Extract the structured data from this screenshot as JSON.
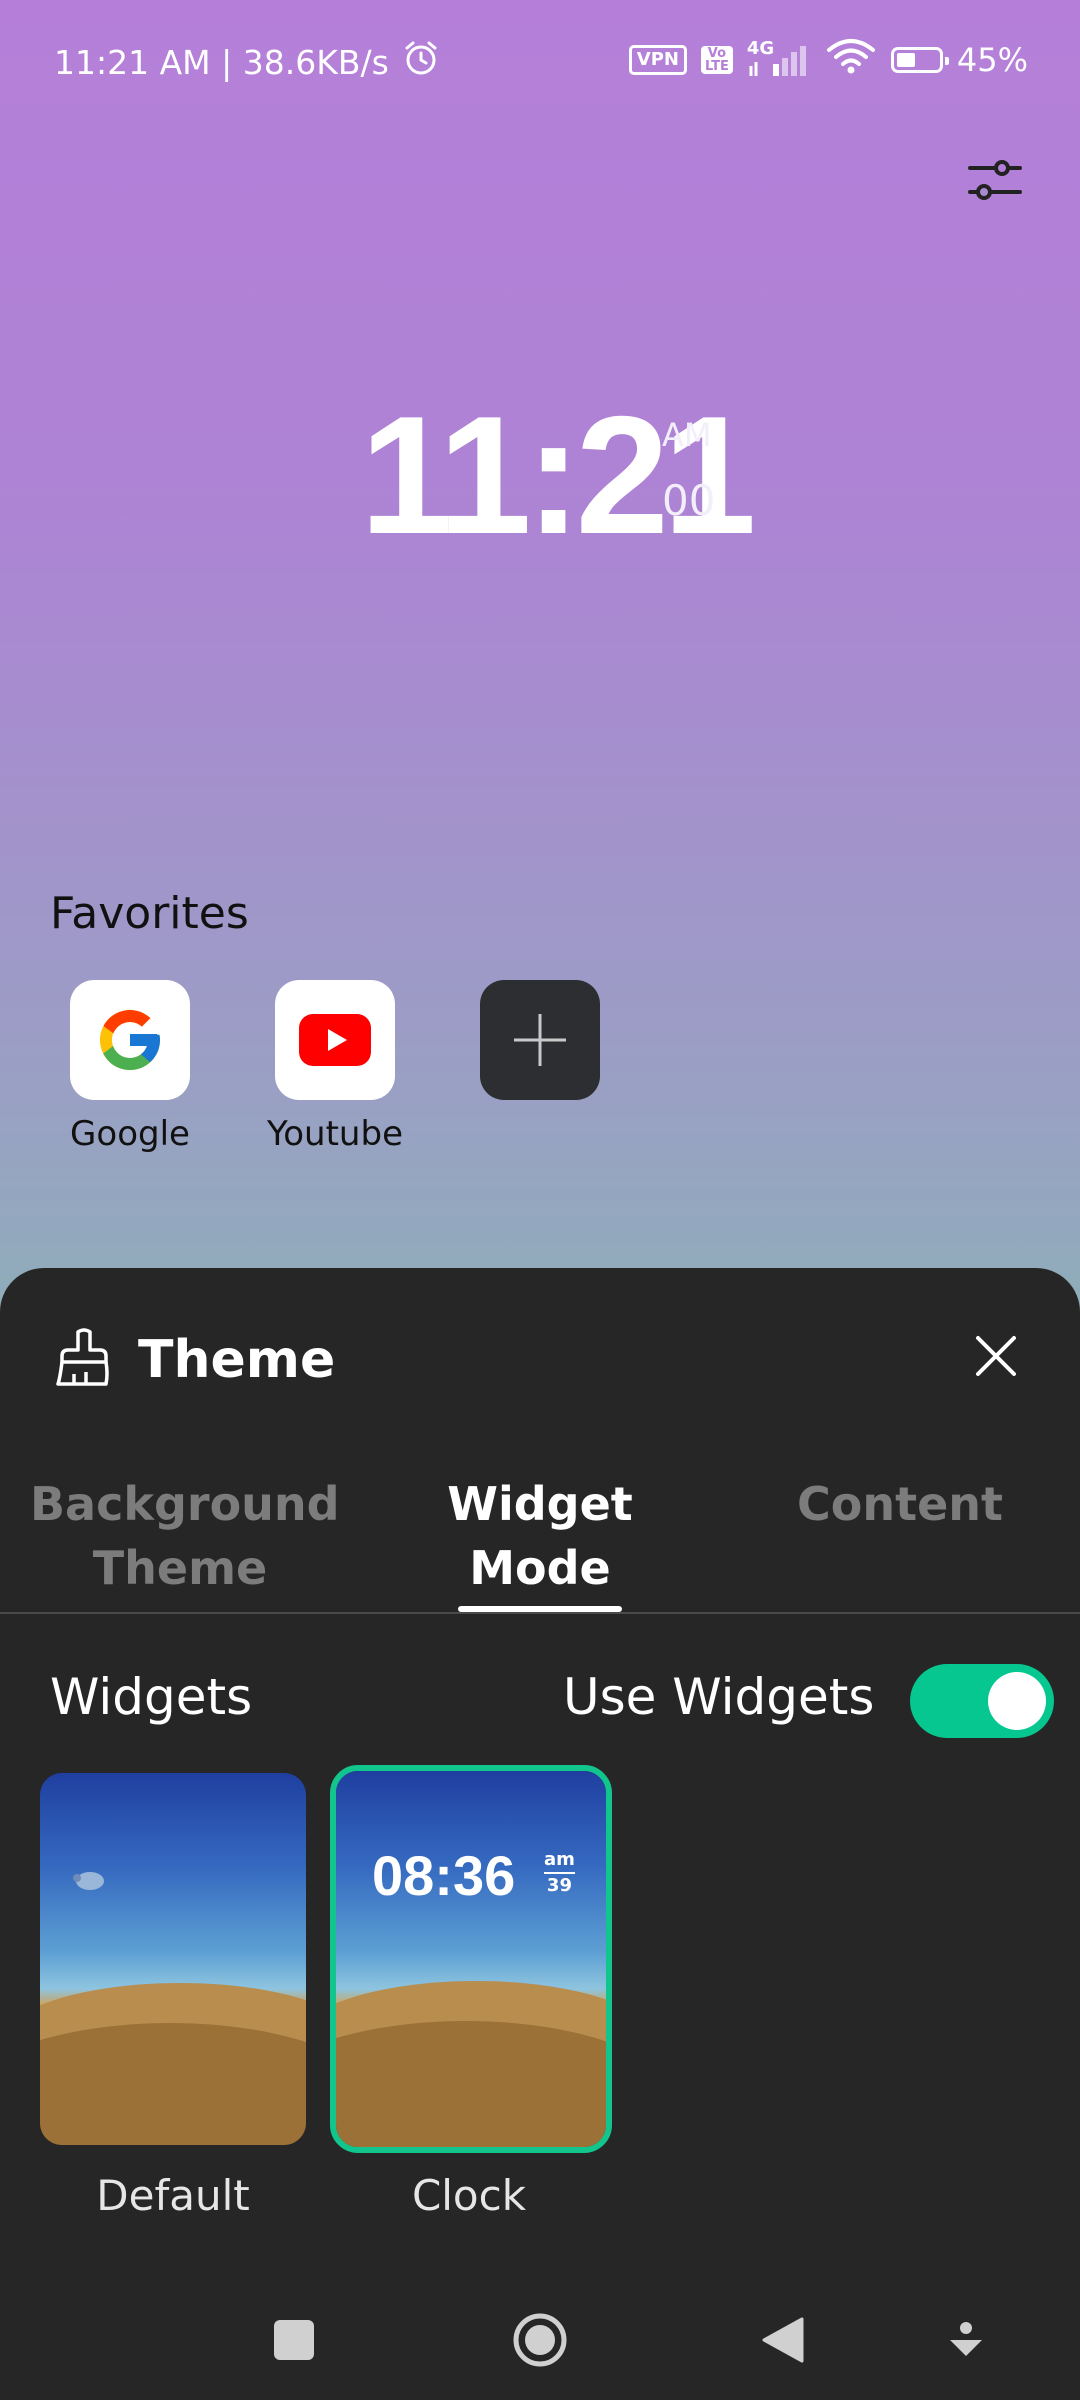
{
  "status_bar": {
    "time_speed": "11:21 AM | 38.6KB/s",
    "vpn": "VPN",
    "volte_top": "Vo",
    "volte_bottom": "LTE",
    "network": "4G",
    "battery": "45%",
    "battery_level": 0.45
  },
  "home": {
    "clock_time": "11:21",
    "clock_ampm": "AM",
    "clock_seconds": "00",
    "favorites_title": "Favorites",
    "favorites": [
      {
        "label": "Google",
        "icon": "google-icon"
      },
      {
        "label": "Youtube",
        "icon": "youtube-icon"
      },
      {
        "label": "",
        "icon": "plus-icon"
      }
    ]
  },
  "sheet": {
    "title": "Theme",
    "tabs": [
      {
        "label": "Background Theme",
        "active": false
      },
      {
        "label": "Widget Mode",
        "active": true
      },
      {
        "label": "Content",
        "active": false
      }
    ],
    "widgets_title": "Widgets",
    "use_widgets_label": "Use Widgets",
    "use_widgets_enabled": true,
    "widget_options": [
      {
        "label": "Default",
        "selected": false
      },
      {
        "label": "Clock",
        "selected": true,
        "preview_time": "08:36",
        "preview_ampm": "am",
        "preview_seconds": "39"
      }
    ]
  },
  "colors": {
    "accent": "#05c78f",
    "sheet_bg": "#262626"
  }
}
